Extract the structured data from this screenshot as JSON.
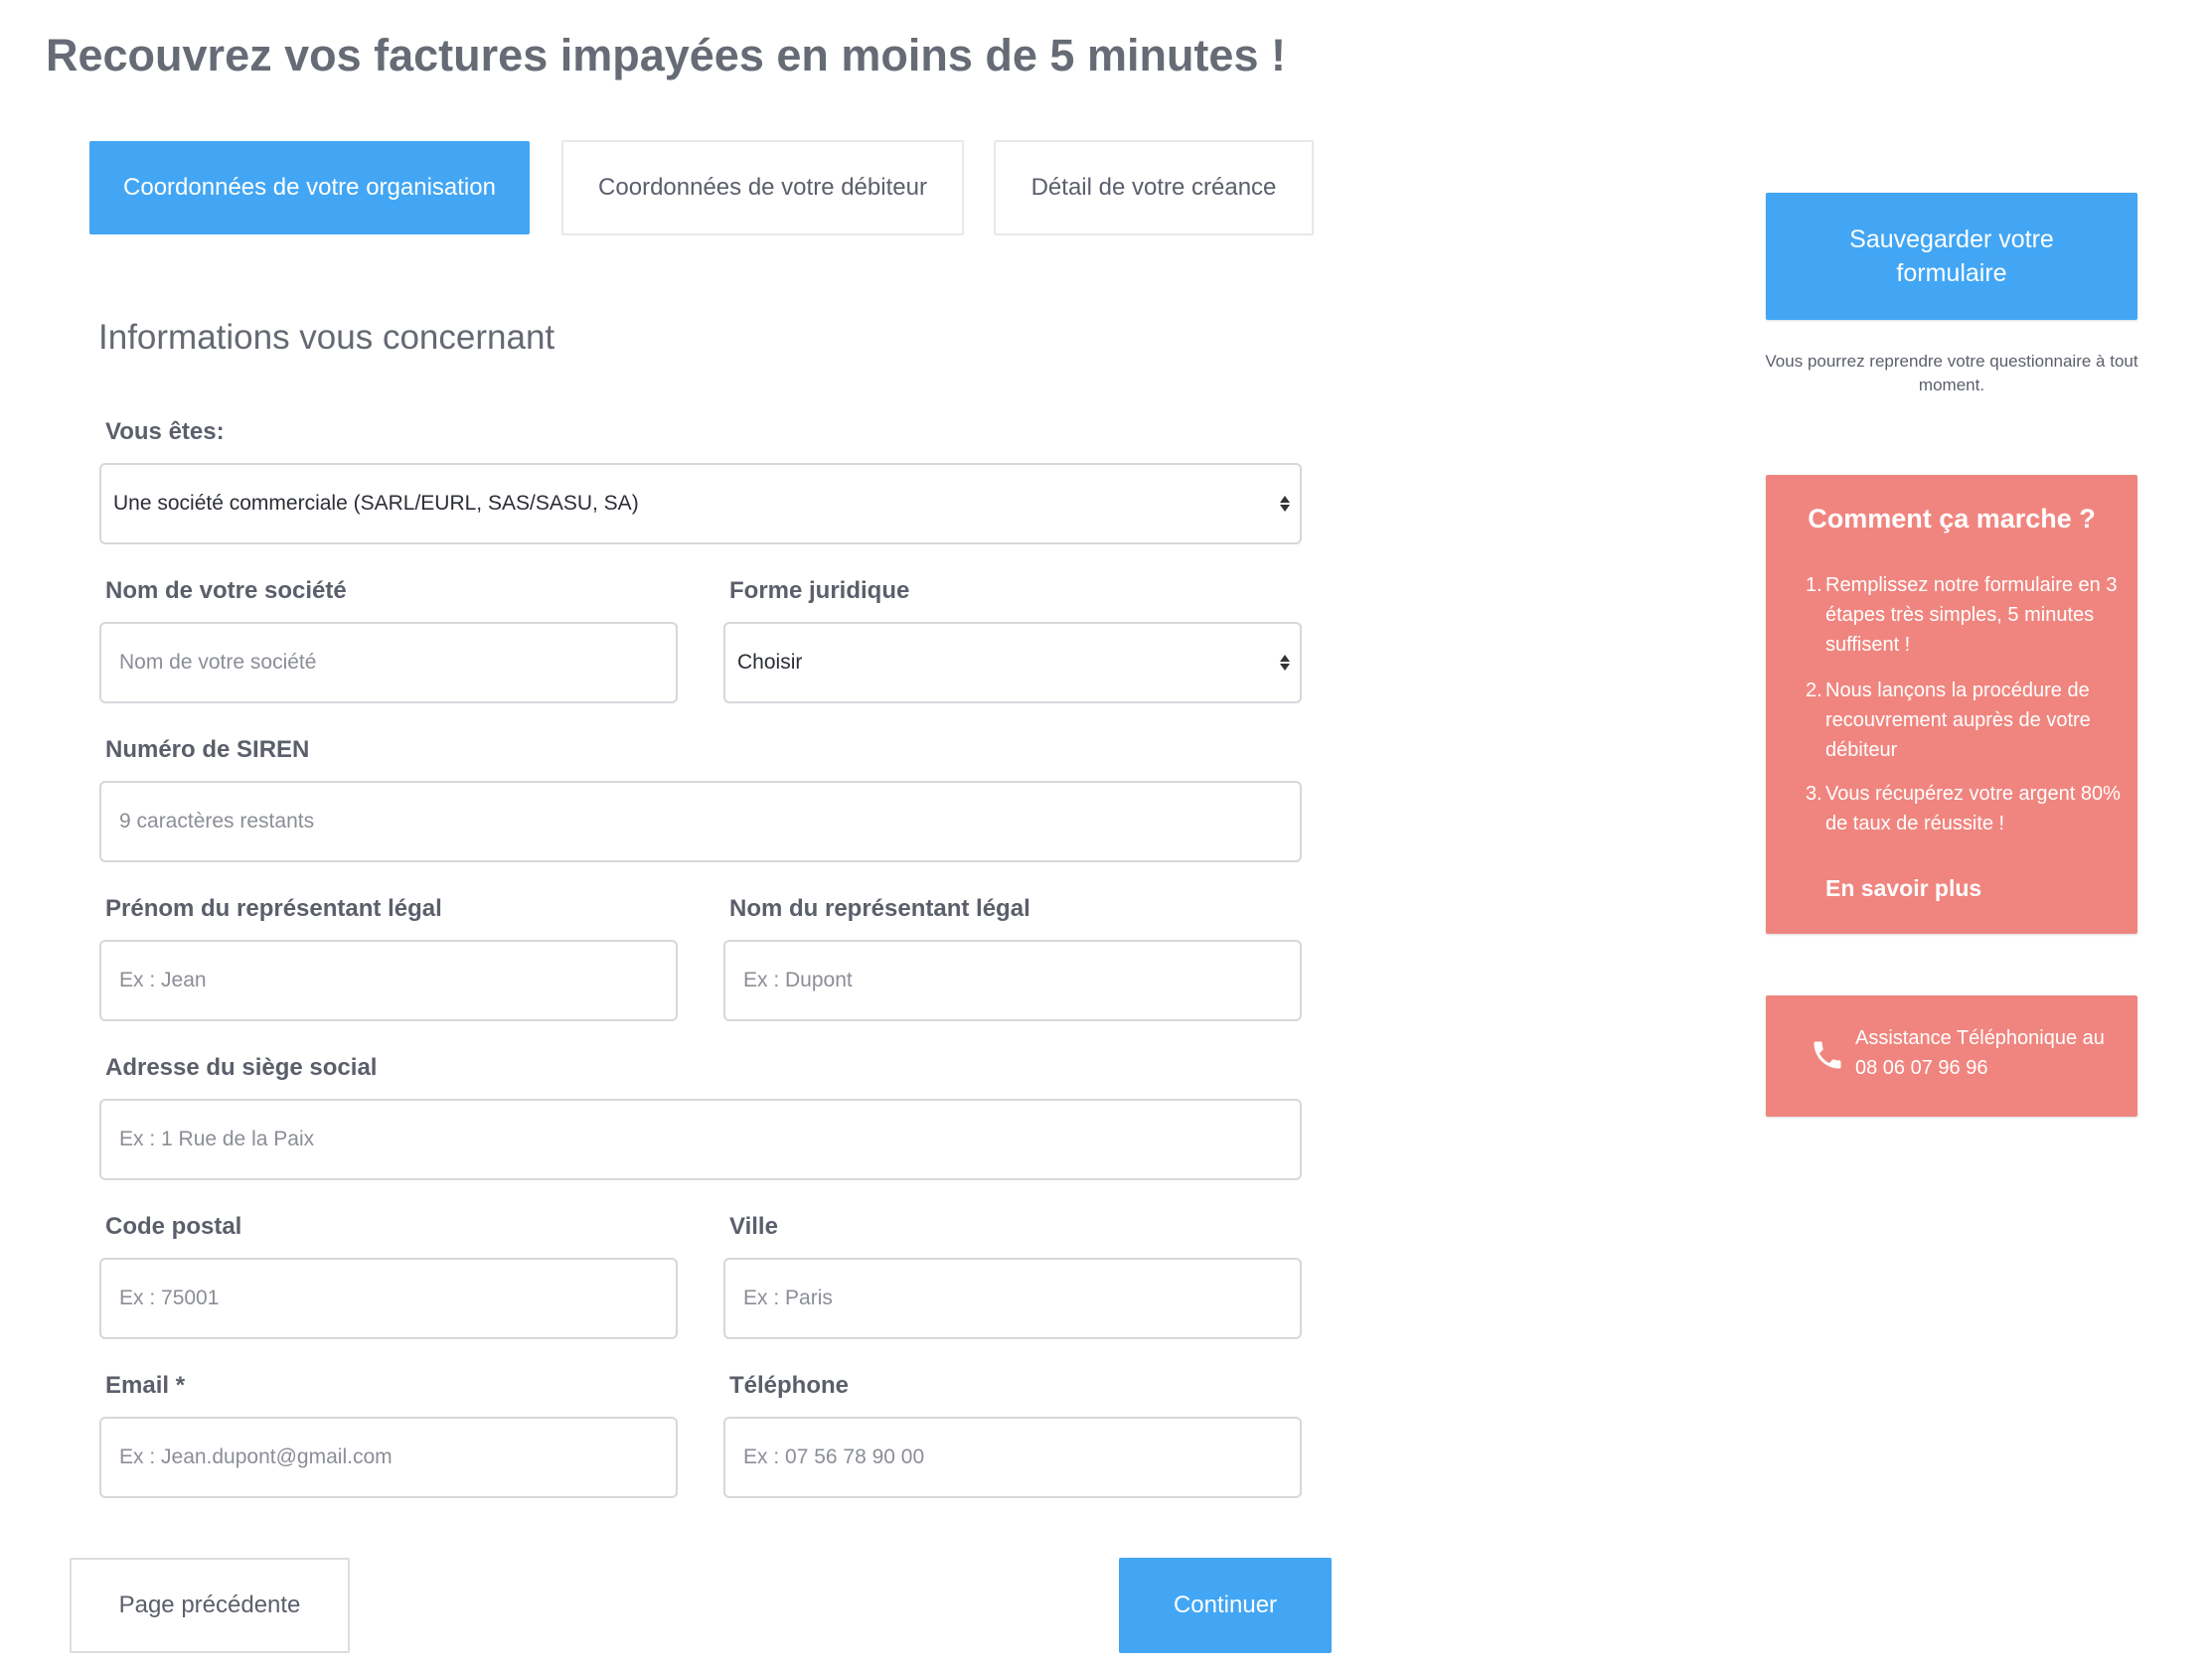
{
  "page": {
    "title": "Recouvrez vos factures impayées en moins de 5 minutes !"
  },
  "tabs": [
    {
      "label": "Coordonnées de votre organisation",
      "active": true
    },
    {
      "label": "Coordonnées de votre débiteur",
      "active": false
    },
    {
      "label": "Détail de votre créance",
      "active": false
    }
  ],
  "section": {
    "title": "Informations vous concernant"
  },
  "form": {
    "vous_etes": {
      "label": "Vous êtes:",
      "value": "Une société commerciale (SARL/EURL, SAS/SASU, SA)"
    },
    "company_name": {
      "label": "Nom de votre société",
      "placeholder": "Nom de votre société"
    },
    "legal_form": {
      "label": "Forme juridique",
      "value": "Choisir"
    },
    "siren": {
      "label": "Numéro de SIREN",
      "placeholder": "9 caractères restants"
    },
    "rep_firstname": {
      "label": "Prénom du représentant légal",
      "placeholder": "Ex : Jean"
    },
    "rep_lastname": {
      "label": "Nom du représentant légal",
      "placeholder": "Ex : Dupont"
    },
    "address": {
      "label": "Adresse du siège social",
      "placeholder": "Ex : 1 Rue de la Paix"
    },
    "postal_code": {
      "label": "Code postal",
      "placeholder": "Ex : 75001"
    },
    "city": {
      "label": "Ville",
      "placeholder": "Ex : Paris"
    },
    "email": {
      "label": "Email *",
      "placeholder": "Ex : Jean.dupont@gmail.com"
    },
    "phone": {
      "label": "Téléphone",
      "placeholder": "Ex : 07 56 78 90 00"
    }
  },
  "actions": {
    "previous_label": "Page précédente",
    "continue_label": "Continuer"
  },
  "sidebar": {
    "save_label": "Sauvegarder votre formulaire",
    "save_note": "Vous pourrez reprendre votre questionnaire à tout moment.",
    "how": {
      "title": "Comment ça marche ?",
      "steps": [
        {
          "num": "1.",
          "text": "Remplissez notre formulaire en 3 étapes très simples, 5 minutes suffisent !"
        },
        {
          "num": "2.",
          "text": "Nous lançons la procédure de recouvrement auprès de votre débiteur"
        },
        {
          "num": "3.",
          "text": "Vous récupérez votre argent 80% de taux de réussite !"
        }
      ],
      "learn_more": "En savoir plus"
    },
    "phone": {
      "text": "Assistance Téléphonique au 08 06 07 96 96",
      "icon": "phone-icon"
    }
  },
  "colors": {
    "primary": "#42a6f4",
    "accent": "#f0857f",
    "text": "#5b5f6b"
  }
}
